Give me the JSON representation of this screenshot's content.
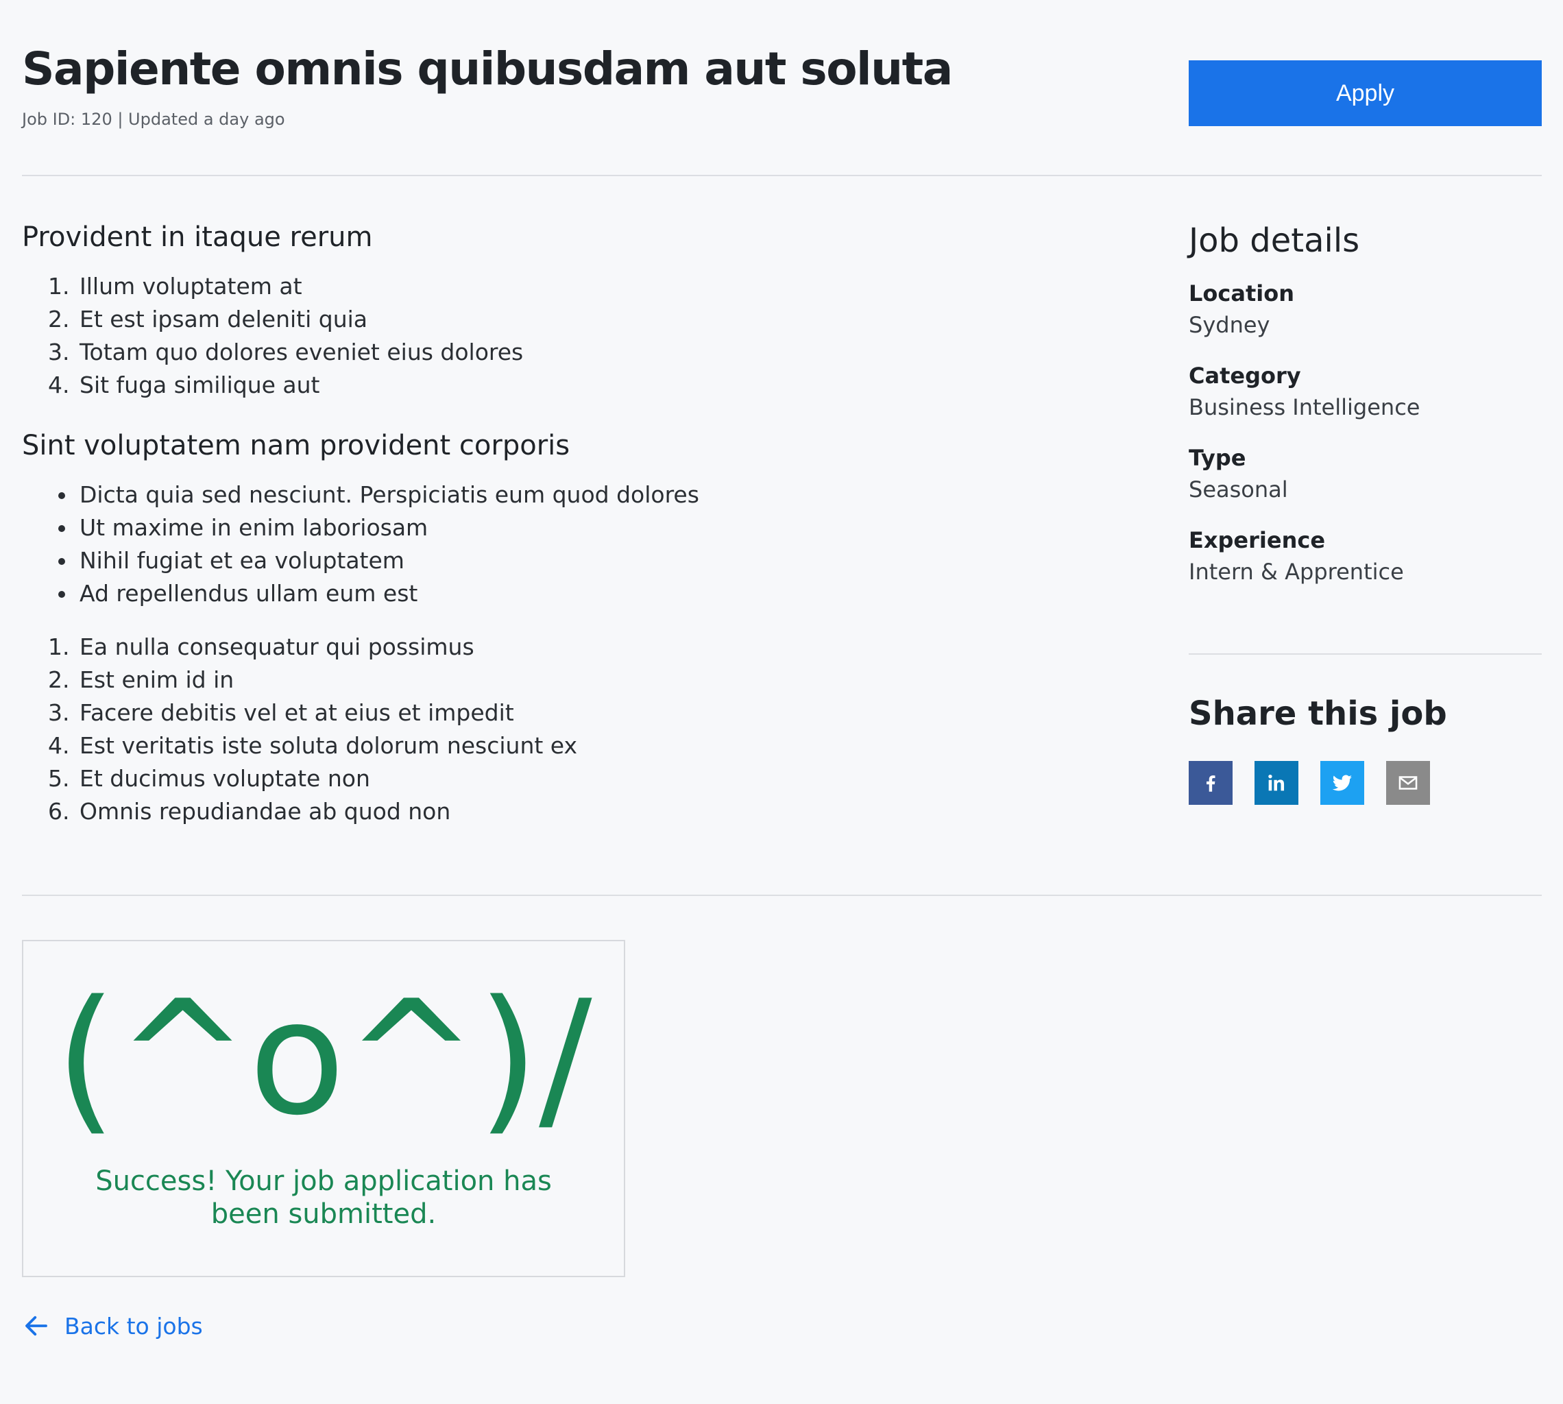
{
  "header": {
    "title": "Sapiente omnis quibusdam aut soluta",
    "meta": "Job ID: 120 | Updated a day ago",
    "apply_label": "Apply"
  },
  "main": {
    "section1": {
      "heading": "Provident in itaque rerum",
      "items": [
        "Illum voluptatem at",
        "Et est ipsam deleniti quia",
        "Totam quo dolores eveniet eius dolores",
        "Sit fuga similique aut"
      ]
    },
    "section2": {
      "heading": "Sint voluptatem nam provident corporis",
      "bullets": [
        "Dicta quia sed nesciunt. Perspiciatis eum quod dolores",
        "Ut maxime in enim laboriosam",
        "Nihil fugiat et ea voluptatem",
        "Ad repellendus ullam eum est"
      ],
      "numbered": [
        "Ea nulla consequatur qui possimus",
        "Est enim id in",
        "Facere debitis vel et at eius et impedit",
        "Est veritatis iste soluta dolorum nesciunt ex",
        "Et ducimus voluptate non",
        "Omnis repudiandae ab quod non"
      ]
    }
  },
  "sidebar": {
    "title": "Job details",
    "details": [
      {
        "label": "Location",
        "value": "Sydney"
      },
      {
        "label": "Category",
        "value": "Business Intelligence"
      },
      {
        "label": "Type",
        "value": "Seasonal"
      },
      {
        "label": "Experience",
        "value": "Intern & Apprentice"
      }
    ],
    "share_title": "Share this job",
    "share_icons": [
      "facebook-icon",
      "linkedin-icon",
      "twitter-icon",
      "email-icon"
    ]
  },
  "success": {
    "kaomoji": "(^o^)/",
    "message": "Success! Your job application has been submitted."
  },
  "footer": {
    "back_label": "Back to jobs"
  },
  "colors": {
    "accent": "#1a73e8",
    "success": "#1a8754",
    "facebook": "#3b5998",
    "linkedin": "#0a77b5",
    "twitter": "#1da1f2",
    "email": "#8a8a8a"
  }
}
